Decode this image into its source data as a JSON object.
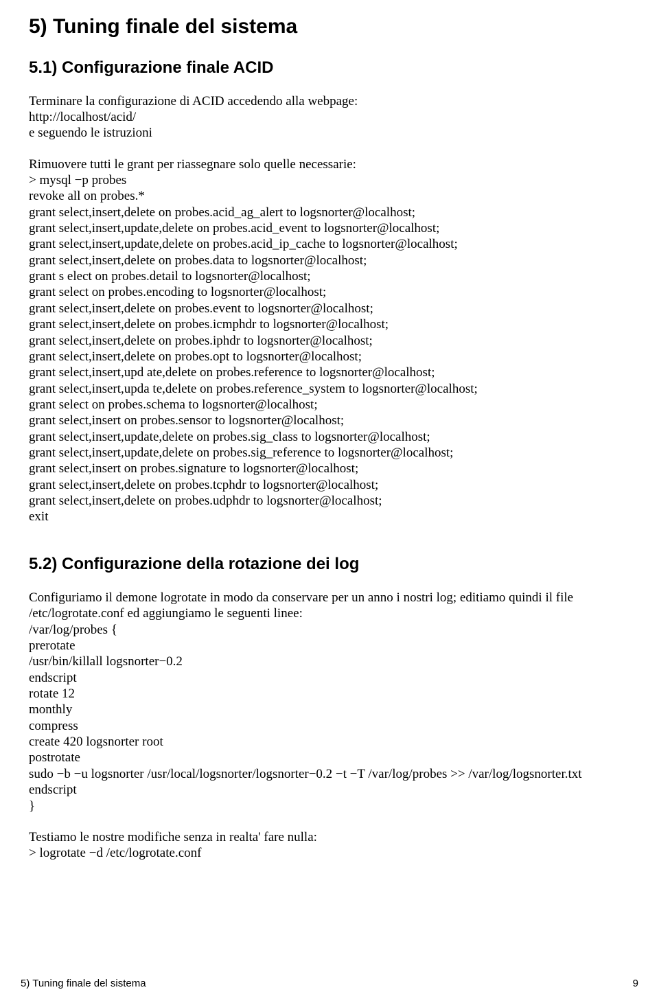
{
  "h1": "5) Tuning finale del sistema",
  "h2a": "5.1) Configurazione finale ACID",
  "p1": "Terminare la configurazione di ACID accedendo alla webpage:\nhttp://localhost/acid/\ne seguendo le istruzioni",
  "p2": "Rimuovere tutti le grant per riassegnare solo quelle necessarie:\n> mysql −p probes\nrevoke all on probes.*\ngrant select,insert,delete on probes.acid_ag_alert to logsnorter@localhost;\ngrant select,insert,update,delete on probes.acid_event to logsnorter@localhost;\ngrant select,insert,update,delete on probes.acid_ip_cache to logsnorter@localhost;\ngrant select,insert,delete on probes.data to logsnorter@localhost;\ngrant s elect on probes.detail to logsnorter@localhost;\ngrant select on probes.encoding to logsnorter@localhost;\ngrant select,insert,delete on probes.event to logsnorter@localhost;\ngrant select,insert,delete on probes.icmphdr to logsnorter@localhost;\ngrant select,insert,delete on probes.iphdr to logsnorter@localhost;\ngrant select,insert,delete on probes.opt to logsnorter@localhost;\ngrant select,insert,upd ate,delete on probes.reference to logsnorter@localhost;\ngrant select,insert,upda te,delete on probes.reference_system to logsnorter@localhost;\ngrant select on probes.schema to logsnorter@localhost;\ngrant select,insert on probes.sensor to logsnorter@localhost;\ngrant select,insert,update,delete on probes.sig_class to logsnorter@localhost;\ngrant select,insert,update,delete on probes.sig_reference to logsnorter@localhost;\ngrant select,insert on probes.signature to logsnorter@localhost;\ngrant select,insert,delete on probes.tcphdr to logsnorter@localhost;\ngrant select,insert,delete on probes.udphdr to logsnorter@localhost;\nexit",
  "h2b": "5.2) Configurazione della rotazione dei log",
  "p3": "Configuriamo il demone logrotate in modo da conservare per un anno i nostri log; editiamo quindi il file /etc/logrotate.conf ed aggiungiamo le seguenti linee:\n/var/log/probes {\nprerotate\n/usr/bin/killall logsnorter−0.2\nendscript\nrotate 12\nmonthly\ncompress\ncreate 420 logsnorter root\npostrotate\nsudo −b −u logsnorter /usr/local/logsnorter/logsnorter−0.2 −t −T /var/log/probes >> /var/log/logsnorter.txt\nendscript\n}",
  "p4": "Testiamo le nostre modifiche senza in realta' fare nulla:\n> logrotate −d /etc/logrotate.conf",
  "footer_left": "5) Tuning finale del sistema",
  "footer_right": "9"
}
